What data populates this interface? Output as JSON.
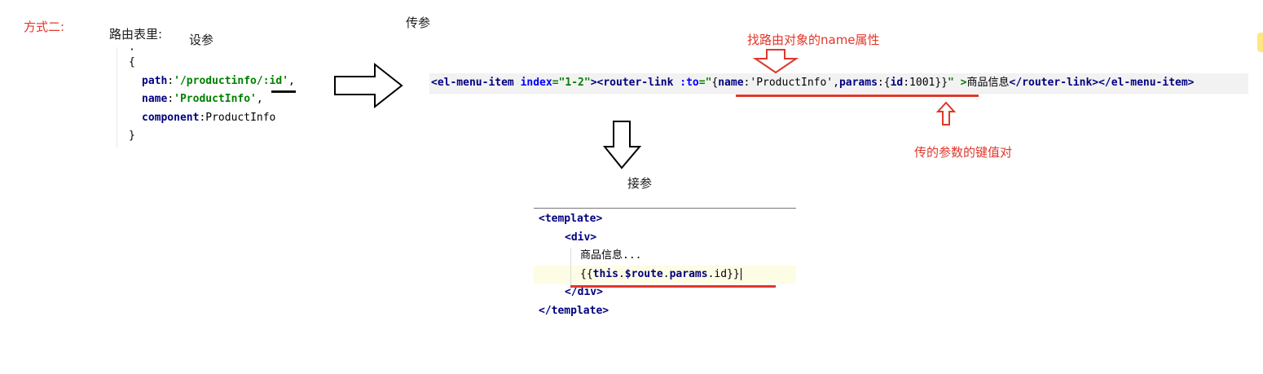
{
  "labels": {
    "method": "方式二:",
    "route_table": "路由表里:",
    "set_param": "设参",
    "pass_param": "传参",
    "receive_param": "接参",
    "name_annotation": "找路由对象的name属性",
    "param_annotation": "传的参数的键值对"
  },
  "route_code": {
    "line0": "·",
    "open_brace": "{",
    "path_key": "path",
    "path_prefix": "'/productinfo/",
    "path_id": ":id",
    "path_suffix": "'",
    "comma": ",",
    "name_key": "name",
    "name_value": "'ProductInfo'",
    "component_key": "component",
    "component_value": "ProductInfo",
    "close_brace": "}"
  },
  "menu_code": {
    "open_tag": "<el-menu-item",
    "index_attr": "index",
    "index_value": "\"1-2\"",
    "close_angle": ">",
    "router_tag": "<router-link",
    "to_attr": ":to",
    "to_quote": "=\"",
    "obj_open": "{",
    "name_key": "name",
    "name_value": ":'ProductInfo'",
    "params_key": "params",
    "params_open": ":{",
    "id_key": "id",
    "id_value": ":1001",
    "obj_close": "}}",
    "end_quote": "\" >",
    "link_text": "商品信息",
    "close_router": "</router-link>",
    "close_menu": "</el-menu-item>"
  },
  "template_code": {
    "open_template": "<template>",
    "open_div": "<div>",
    "text": "商品信息...",
    "mustache_open": "{{",
    "this_kw": "this",
    "dot1": ".",
    "route_kw": "$route",
    "dot2": ".",
    "params_kw": "params",
    "dot3": ".",
    "id_kw": "id",
    "mustache_close": "}}",
    "close_div": "</div>",
    "close_template": "</template>"
  },
  "colors": {
    "annotation": "#e0372b",
    "tag": "#000080",
    "string": "#008000",
    "attr": "#0000ff"
  }
}
